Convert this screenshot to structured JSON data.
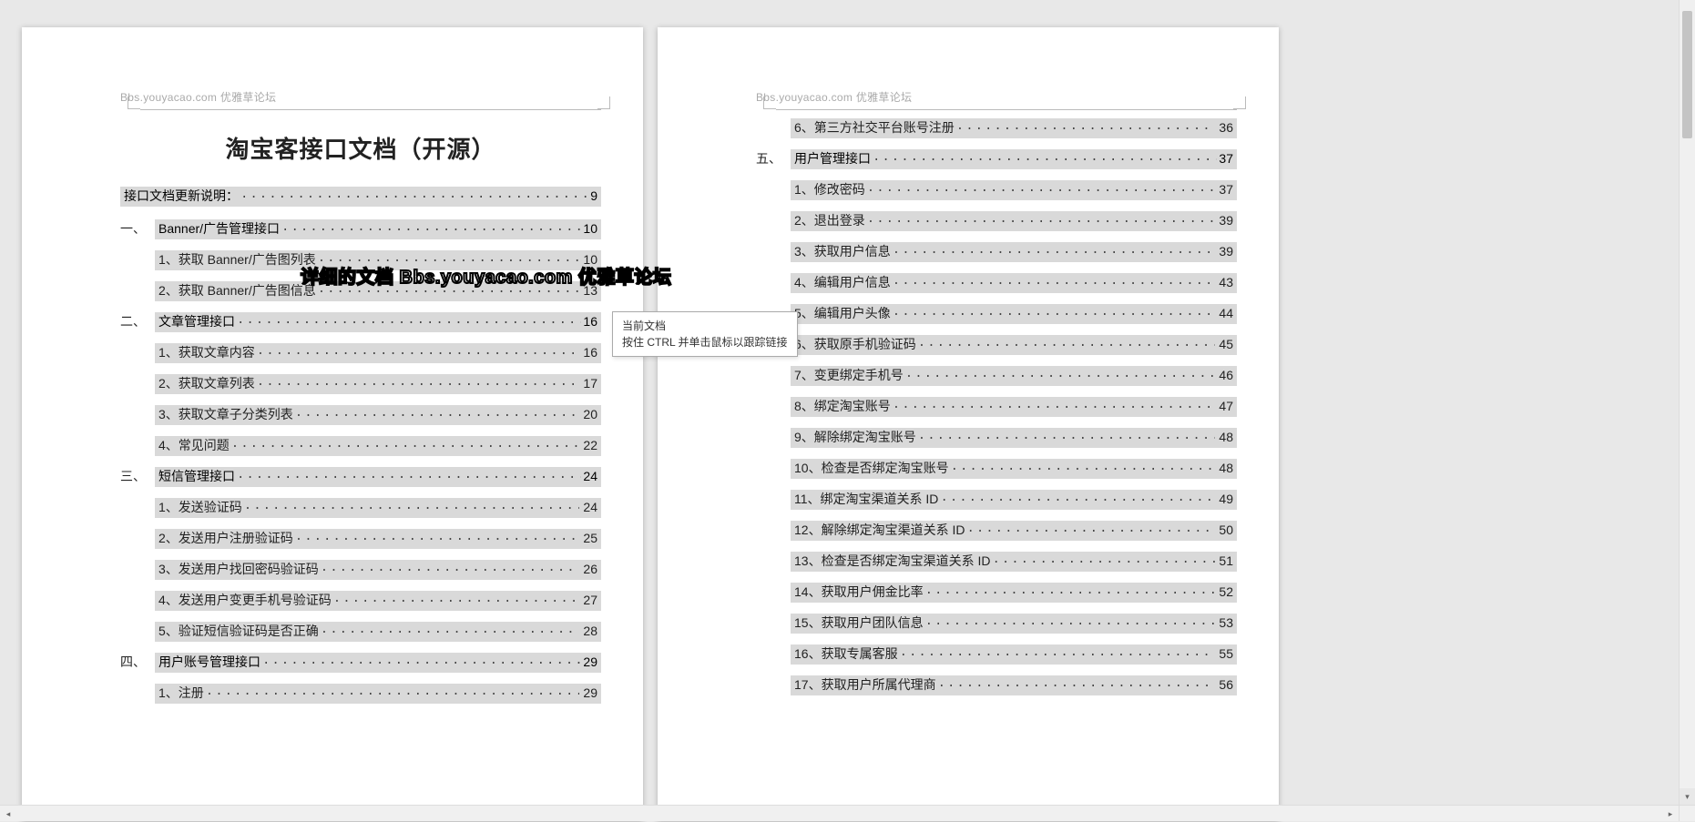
{
  "watermark": "Bbs.youyacao.com  优雅草论坛",
  "doc_title": "淘宝客接口文档（开源）",
  "floating_watermark": "详细的文档 Bbs.youyacao.com 优雅草论坛",
  "tooltip": {
    "line1": "当前文档",
    "line2": "按住 CTRL 并单击鼠标以跟踪链接"
  },
  "page1": {
    "intro": {
      "label": "接口文档更新说明：",
      "page": "9"
    },
    "sections": [
      {
        "prefix": "一、",
        "label": "Banner/广告管理接口",
        "page": "10",
        "items": [
          {
            "label": "1、获取 Banner/广告图列表",
            "page": "10"
          },
          {
            "label": "2、获取 Banner/广告图信息",
            "page": "13"
          }
        ]
      },
      {
        "prefix": "二、",
        "label": "文章管理接口",
        "page": "16",
        "items": [
          {
            "label": "1、获取文章内容",
            "page": "16"
          },
          {
            "label": "2、获取文章列表",
            "page": "17"
          },
          {
            "label": "3、获取文章子分类列表",
            "page": "20"
          },
          {
            "label": "4、常见问题",
            "page": "22"
          }
        ]
      },
      {
        "prefix": "三、",
        "label": "短信管理接口",
        "page": "24",
        "items": [
          {
            "label": "1、发送验证码",
            "page": "24"
          },
          {
            "label": "2、发送用户注册验证码",
            "page": "25"
          },
          {
            "label": "3、发送用户找回密码验证码",
            "page": "26"
          },
          {
            "label": "4、发送用户变更手机号验证码",
            "page": "27"
          },
          {
            "label": "5、验证短信验证码是否正确",
            "page": "28"
          }
        ]
      },
      {
        "prefix": "四、",
        "label": "用户账号管理接口",
        "page": "29",
        "items": [
          {
            "label": "1、注册",
            "page": "29"
          }
        ]
      }
    ]
  },
  "page2": {
    "top_items": [
      {
        "label": "6、第三方社交平台账号注册",
        "page": "36"
      }
    ],
    "sections": [
      {
        "prefix": "五、",
        "label": "用户管理接口",
        "page": "37",
        "items": [
          {
            "label": "1、修改密码",
            "page": "37"
          },
          {
            "label": "2、退出登录",
            "page": "39"
          },
          {
            "label": "3、获取用户信息",
            "page": "39"
          },
          {
            "label": "4、编辑用户信息",
            "page": "43"
          },
          {
            "label": "5、编辑用户头像",
            "page": "44"
          },
          {
            "label": "6、获取原手机验证码",
            "page": "45"
          },
          {
            "label": "7、变更绑定手机号",
            "page": "46"
          },
          {
            "label": "8、绑定淘宝账号",
            "page": "47"
          },
          {
            "label": "9、解除绑定淘宝账号",
            "page": "48"
          },
          {
            "label": "10、检查是否绑定淘宝账号",
            "page": "48"
          },
          {
            "label": "11、绑定淘宝渠道关系 ID",
            "page": "49"
          },
          {
            "label": "12、解除绑定淘宝渠道关系 ID",
            "page": "50"
          },
          {
            "label": "13、检查是否绑定淘宝渠道关系 ID",
            "page": "51"
          },
          {
            "label": "14、获取用户佣金比率",
            "page": "52"
          },
          {
            "label": "15、获取用户团队信息",
            "page": "53"
          },
          {
            "label": "16、获取专属客服",
            "page": "55"
          },
          {
            "label": "17、获取用户所属代理商",
            "page": "56"
          }
        ]
      }
    ]
  },
  "dots_fill": "························································································································"
}
